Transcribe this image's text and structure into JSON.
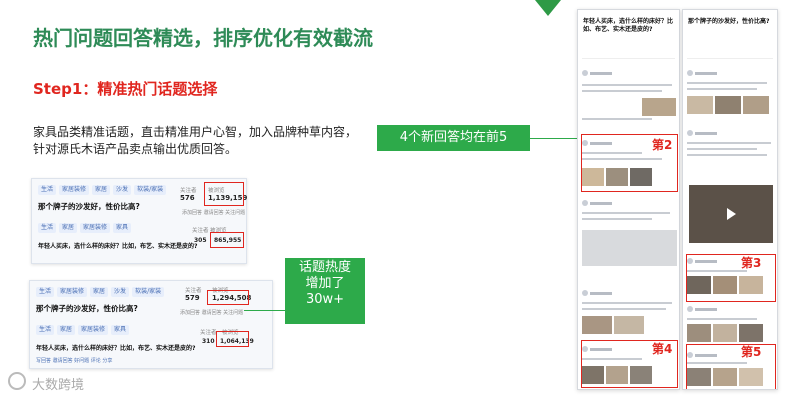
{
  "slide": {
    "title": "热门问题回答精选，排序优化有效截流",
    "step": "Step1：精准热门话题选择",
    "description": "家具品类精准话题，直击精准用户心智，加入品牌种草内容，针对源氏木语产品卖点输出优质回答。"
  },
  "callouts": {
    "top5": "4个新回答均在前5",
    "heat_line1": "话题热度",
    "heat_line2": "增加了",
    "heat_line3": "30w+"
  },
  "card1": {
    "tags": [
      "生活",
      "家居装修",
      "家居",
      "沙发",
      "软装/家装"
    ],
    "q1": "那个牌子的沙发好，性价比高?",
    "q1_answers_label": "关注者",
    "q1_answers": "576",
    "q1_views_label": "被浏览",
    "q1_views": "1,139,159",
    "q1_meta": "添加回答 邀请回答 关注问题",
    "tags2": [
      "生活",
      "家居",
      "家居装修",
      "家具"
    ],
    "q2": "年轻人买床，选什么样的床好？比如，布艺、实木还是皮的?",
    "q2_answers_label": "关注者",
    "q2_answers": "305",
    "q2_views_label": "被浏览",
    "q2_views": "865,955"
  },
  "card2": {
    "tags": [
      "生活",
      "家居装修",
      "家居",
      "沙发",
      "软装/家装"
    ],
    "q1": "那个牌子的沙发好，性价比高?",
    "q1_answers_label": "关注者",
    "q1_answers": "579",
    "q1_views_label": "被浏览",
    "q1_views": "1,294,508",
    "q1_meta": "添加回答 邀请回答 关注问题",
    "tags2": [
      "生活",
      "家居",
      "家居装修",
      "家具"
    ],
    "q2": "年轻人买床，选什么样的床好？比如，布艺、实木还是皮的?",
    "q2_answers_label": "关注者",
    "q2_answers": "310",
    "q2_views_label": "被浏览",
    "q2_views": "1,064,139",
    "q2_meta": "写回答 邀请回答 好问题 评论 分享"
  },
  "phone1": {
    "question": "年轻人买床，选什么样的床好？比如、布艺、实木还是皮的?",
    "ranks": [
      "第2",
      "第4"
    ]
  },
  "phone2": {
    "question": "那个牌子的沙发好，性价比高?",
    "ranks": [
      "第3",
      "第5"
    ]
  },
  "watermark": "大数跨境",
  "colors": {
    "accent_green": "#2daa4a",
    "title_green": "#2e8b57",
    "red": "#e0261f"
  }
}
